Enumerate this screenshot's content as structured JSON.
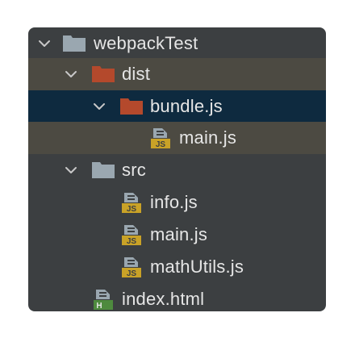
{
  "colors": {
    "panel_bg": "#3c3f41",
    "folder_grey": "#9aa7b0",
    "folder_orange": "#b4492c",
    "selected_row": "#0e2a3f",
    "highlight_row": "#4c4a42",
    "js_badge": "#c9a227",
    "html_badge": "#4e8a3e",
    "text": "#e6e6e6"
  },
  "tree": {
    "root": {
      "label": "webpackTest",
      "icon": "folder-icon",
      "expanded": true
    },
    "dist": {
      "label": "dist",
      "icon": "excluded-folder-icon",
      "expanded": true
    },
    "bundle": {
      "label": "bundle.js",
      "icon": "excluded-folder-icon",
      "expanded": true,
      "selected": true
    },
    "bundle_main": {
      "label": "main.js",
      "icon": "js-file-icon",
      "js_badge": "JS"
    },
    "src": {
      "label": "src",
      "icon": "folder-icon",
      "expanded": true
    },
    "info": {
      "label": "info.js",
      "icon": "js-file-icon",
      "js_badge": "JS"
    },
    "src_main": {
      "label": "main.js",
      "icon": "js-file-icon",
      "js_badge": "JS"
    },
    "mathutils": {
      "label": "mathUtils.js",
      "icon": "js-file-icon",
      "js_badge": "JS"
    },
    "index": {
      "label": "index.html",
      "icon": "html-file-icon",
      "html_badge": "H"
    }
  }
}
